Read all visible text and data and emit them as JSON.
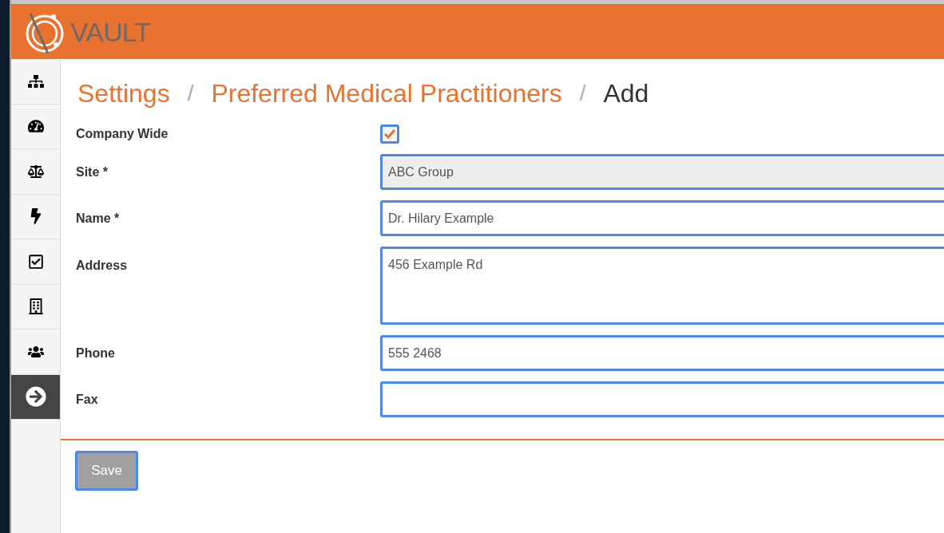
{
  "header": {
    "logo_text": "VAULT"
  },
  "sidebar": {
    "items": [
      {
        "kind": "sitemap",
        "selected": false
      },
      {
        "kind": "dashboard",
        "selected": false
      },
      {
        "kind": "scale",
        "selected": false
      },
      {
        "kind": "bolt",
        "selected": false
      },
      {
        "kind": "checklist",
        "selected": false
      },
      {
        "kind": "building",
        "selected": false
      },
      {
        "kind": "users",
        "selected": false
      },
      {
        "kind": "arrow",
        "selected": true
      }
    ]
  },
  "breadcrumb": [
    {
      "label": "Settings",
      "kind": "link"
    },
    {
      "label": "/",
      "kind": "separator"
    },
    {
      "label": "Preferred Medical Practitioners",
      "kind": "link"
    },
    {
      "label": "/",
      "kind": "separator"
    },
    {
      "label": "Add",
      "kind": "current"
    }
  ],
  "form": {
    "fields": [
      {
        "kind": "checkbox",
        "label": "Company Wide",
        "checked": true
      },
      {
        "kind": "text",
        "label": "Site *",
        "value": "ABC Group",
        "disabled": true
      },
      {
        "kind": "text",
        "label": "Name *",
        "value": "Dr. Hilary Example",
        "disabled": false
      },
      {
        "kind": "textarea",
        "label": "Address",
        "value": "456 Example Rd",
        "disabled": false
      },
      {
        "kind": "text",
        "label": "Phone",
        "value": "555 2468",
        "disabled": false
      },
      {
        "kind": "text",
        "label": "Fax",
        "disabled": false
      }
    ]
  },
  "save_button": {
    "label": "Save"
  }
}
